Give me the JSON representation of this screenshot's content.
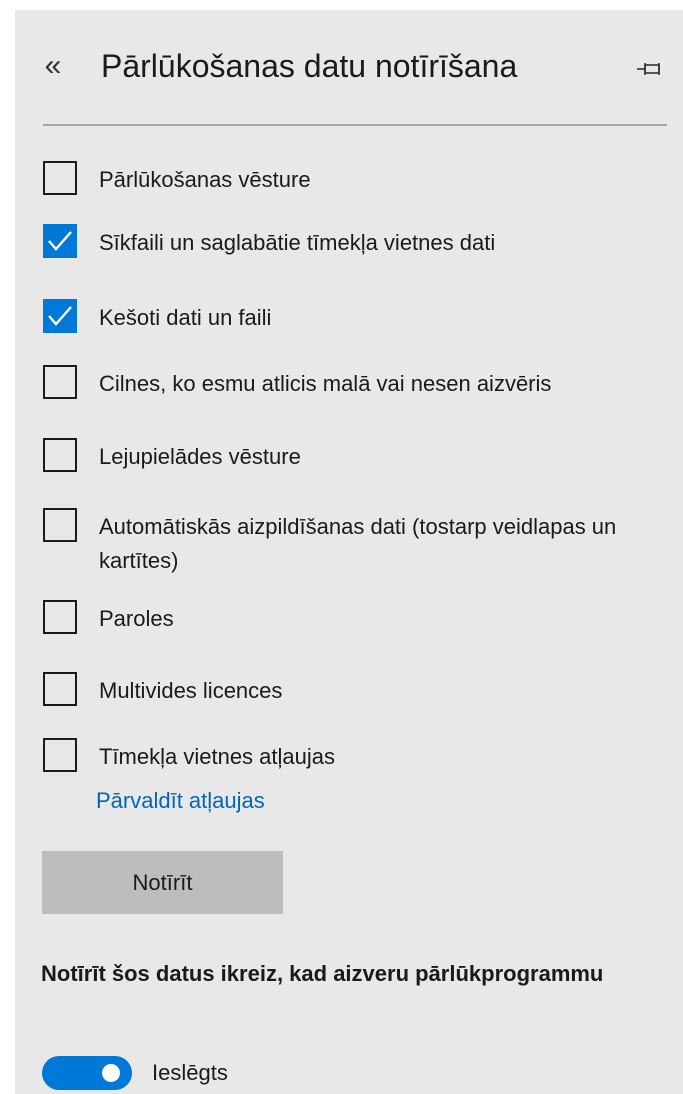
{
  "header": {
    "back_glyph": "«",
    "title": "Pārlūkošanas datu notīrīšana",
    "pin_icon": "pin-icon"
  },
  "options": [
    {
      "label": "Pārlūkošanas vēsture",
      "checked": false
    },
    {
      "label": "Sīkfaili un saglabātie tīmekļa vietnes dati",
      "checked": true
    },
    {
      "label": "Kešoti dati un faili",
      "checked": true
    },
    {
      "label": "Cilnes, ko esmu atlicis malā vai nesen aizvēris",
      "checked": false
    },
    {
      "label": "Lejupielādes vēsture",
      "checked": false
    },
    {
      "label": "Automātiskās aizpildīšanas dati (tostarp veidlapas un kartītes)",
      "checked": false
    },
    {
      "label": "Paroles",
      "checked": false
    },
    {
      "label": "Multivides licences",
      "checked": false
    },
    {
      "label": "Tīmekļa vietnes atļaujas",
      "checked": false
    }
  ],
  "manage_permissions_link": "Pārvaldīt atļaujas",
  "clear_button": "Notīrīt",
  "auto_clear": {
    "heading": "Notīrīt šos datus ikreiz, kad aizveru pārlūkprogrammu",
    "toggle_on": true,
    "toggle_label": "Ieslēgts"
  },
  "colors": {
    "panel_bg": "#e8e8e8",
    "accent": "#0078d7",
    "link": "#0067b8",
    "button_bg": "#bdbdbd"
  }
}
